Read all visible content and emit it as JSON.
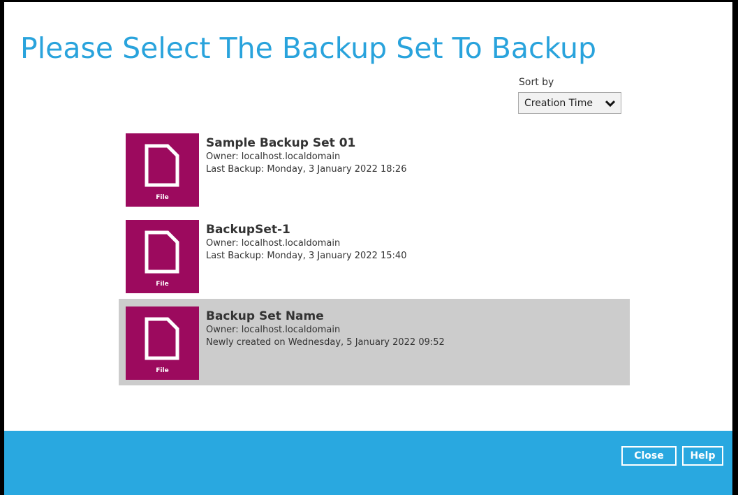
{
  "title": "Please Select The Backup Set To Backup",
  "sort": {
    "label": "Sort by",
    "selected": "Creation Time",
    "icon": "chevron-down-icon"
  },
  "backup_sets": [
    {
      "name": "Sample Backup Set 01",
      "owner": "Owner: localhost.localdomain",
      "detail": "Last Backup: Monday, 3 January 2022 18:26",
      "type": "File",
      "icon": "file-icon",
      "selected": false
    },
    {
      "name": "BackupSet-1",
      "owner": "Owner: localhost.localdomain",
      "detail": "Last Backup: Monday, 3 January 2022 15:40",
      "type": "File",
      "icon": "file-icon",
      "selected": false
    },
    {
      "name": "Backup Set Name",
      "owner": "Owner: localhost.localdomain",
      "detail": "Newly created on Wednesday, 5 January 2022 09:52",
      "type": "File",
      "icon": "file-icon",
      "selected": true
    }
  ],
  "footer": {
    "close_label": "Close",
    "help_label": "Help"
  },
  "colors": {
    "title": "#29a3dc",
    "tile": "#9c0a5e",
    "footer": "#29a8e0",
    "selected_row": "#cccccc"
  }
}
